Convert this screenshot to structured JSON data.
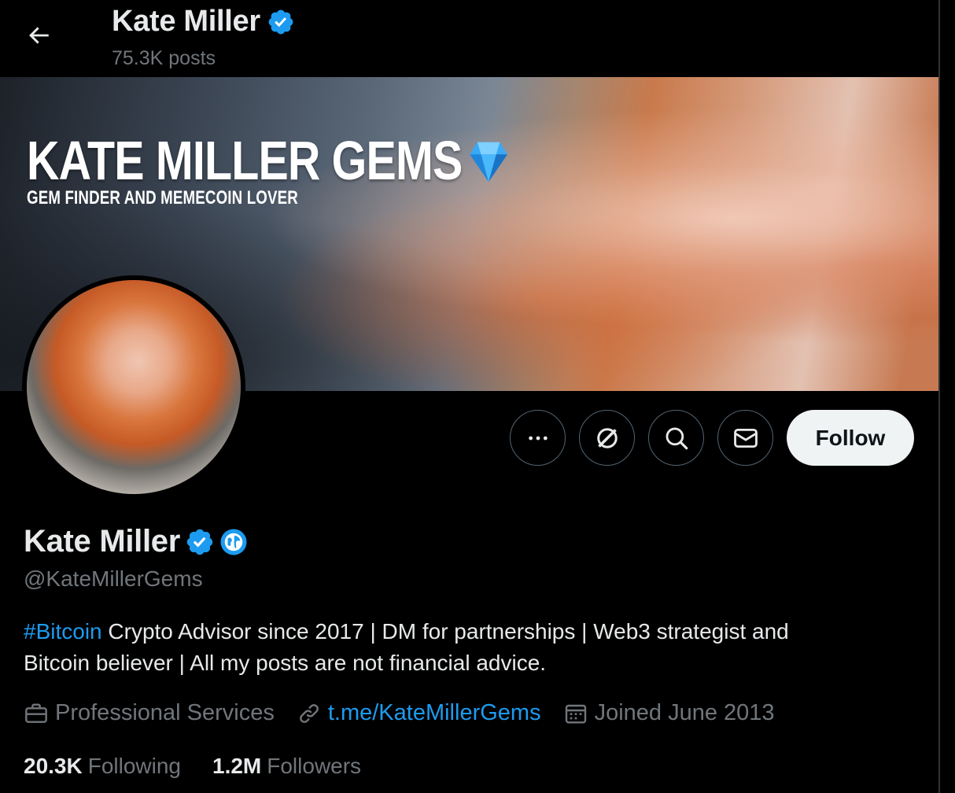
{
  "header": {
    "name": "Kate Miller",
    "posts_count": "75.3K posts"
  },
  "banner": {
    "title": "KATE MILLER GEMS",
    "subtitle": "GEM FINDER AND MEMECOIN LOVER"
  },
  "actions": {
    "follow_label": "Follow"
  },
  "profile": {
    "name": "Kate Miller",
    "handle": "@KateMillerGems",
    "bio_hashtag": "#Bitcoin",
    "bio_line1_rest": " Crypto Advisor since 2017 | DM for partnerships | Web3 strategist and",
    "bio_line2": "Bitcoin believer | All my posts are not financial advice.",
    "category": "Professional Services",
    "link": "t.me/KateMillerGems",
    "joined": "Joined June 2013"
  },
  "stats": {
    "following_count": "20.3K",
    "following_label": "Following",
    "followers_count": "1.2M",
    "followers_label": "Followers"
  },
  "colors": {
    "accent": "#1d9bf0",
    "muted": "#71767b",
    "text": "#e7e9ea",
    "background": "#000000"
  }
}
